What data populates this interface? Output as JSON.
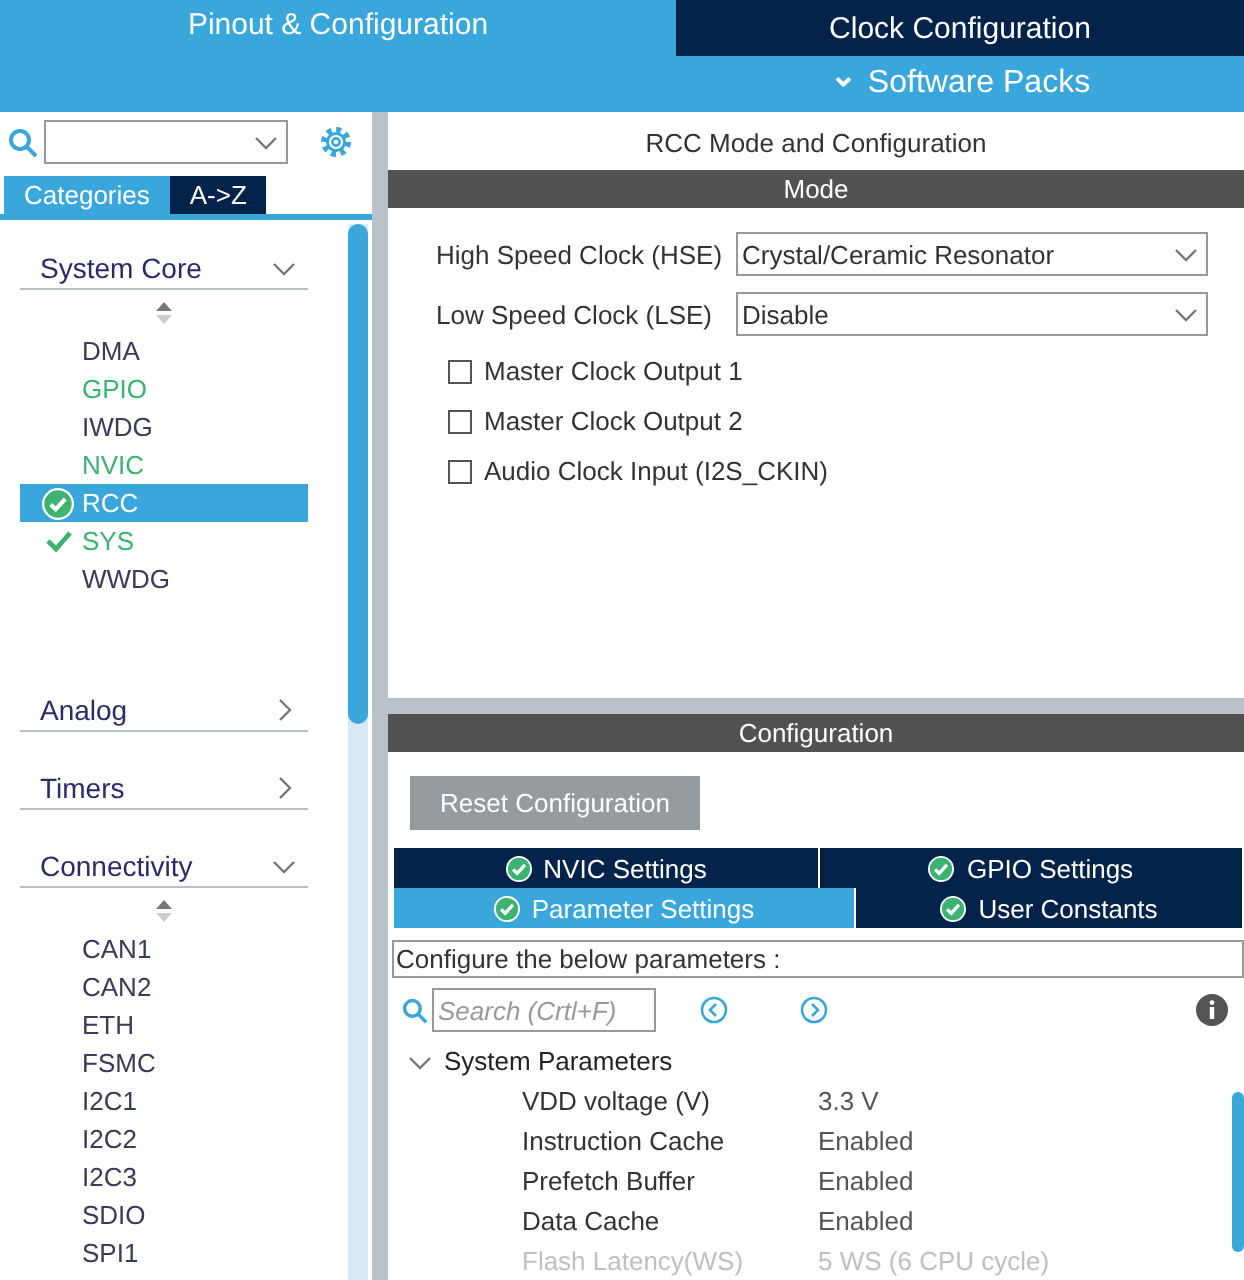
{
  "top_tabs": [
    {
      "label": "Pinout & Configuration",
      "selected": true
    },
    {
      "label": "Clock Configuration",
      "selected": false
    }
  ],
  "software_packs": {
    "icon": "⌄",
    "label": "Software Packs"
  },
  "sidebar": {
    "view_tabs": [
      {
        "label": "Categories",
        "selected": true
      },
      {
        "label": "A->Z",
        "selected": false
      }
    ],
    "sections": [
      {
        "title": "System Core",
        "expanded": true,
        "items": [
          {
            "label": "DMA",
            "configured": false,
            "checked": false,
            "selected": false
          },
          {
            "label": "GPIO",
            "configured": true,
            "checked": false,
            "selected": false
          },
          {
            "label": "IWDG",
            "configured": false,
            "checked": false,
            "selected": false
          },
          {
            "label": "NVIC",
            "configured": true,
            "checked": false,
            "selected": false
          },
          {
            "label": "RCC",
            "configured": true,
            "checked": true,
            "selected": true
          },
          {
            "label": "SYS",
            "configured": true,
            "checked": true,
            "selected": false
          },
          {
            "label": "WWDG",
            "configured": false,
            "checked": false,
            "selected": false
          }
        ]
      },
      {
        "title": "Analog",
        "expanded": false
      },
      {
        "title": "Timers",
        "expanded": false
      },
      {
        "title": "Connectivity",
        "expanded": true,
        "items": [
          {
            "label": "CAN1",
            "configured": false,
            "checked": false,
            "selected": false
          },
          {
            "label": "CAN2",
            "configured": false,
            "checked": false,
            "selected": false
          },
          {
            "label": "ETH",
            "configured": false,
            "checked": false,
            "selected": false
          },
          {
            "label": "FSMC",
            "configured": false,
            "checked": false,
            "selected": false
          },
          {
            "label": "I2C1",
            "configured": false,
            "checked": false,
            "selected": false
          },
          {
            "label": "I2C2",
            "configured": false,
            "checked": false,
            "selected": false
          },
          {
            "label": "I2C3",
            "configured": false,
            "checked": false,
            "selected": false
          },
          {
            "label": "SDIO",
            "configured": false,
            "checked": false,
            "selected": false
          },
          {
            "label": "SPI1",
            "configured": false,
            "checked": false,
            "selected": false
          }
        ]
      }
    ]
  },
  "mode_panel": {
    "title": "RCC Mode and Configuration",
    "header": "Mode",
    "selects": [
      {
        "label": "High Speed Clock (HSE)",
        "value": "Crystal/Ceramic Resonator"
      },
      {
        "label": "Low Speed Clock (LSE)",
        "value": "Disable"
      }
    ],
    "checkboxes": [
      {
        "label": "Master Clock Output 1",
        "checked": false
      },
      {
        "label": "Master Clock Output 2",
        "checked": false
      },
      {
        "label": "Audio Clock Input (I2S_CKIN)",
        "checked": false
      }
    ]
  },
  "config_panel": {
    "header": "Configuration",
    "reset_button": "Reset Configuration",
    "tabs": [
      [
        {
          "label": "NVIC Settings",
          "selected": false
        },
        {
          "label": "GPIO Settings",
          "selected": false
        }
      ],
      [
        {
          "label": "Parameter Settings",
          "selected": true
        },
        {
          "label": "User Constants",
          "selected": false
        }
      ]
    ],
    "hint": "Configure the below parameters :",
    "search": {
      "placeholder": "Search (Crtl+F)"
    },
    "groups": [
      {
        "title": "System Parameters",
        "expanded": true,
        "rows": [
          {
            "name": "VDD voltage (V)",
            "value": "3.3 V",
            "disabled": false
          },
          {
            "name": "Instruction Cache",
            "value": "Enabled",
            "disabled": false
          },
          {
            "name": "Prefetch Buffer",
            "value": "Enabled",
            "disabled": false
          },
          {
            "name": "Data Cache",
            "value": "Enabled",
            "disabled": false
          },
          {
            "name": "Flash Latency(WS)",
            "value": "5 WS (6 CPU cycle)",
            "disabled": true
          }
        ]
      }
    ]
  }
}
